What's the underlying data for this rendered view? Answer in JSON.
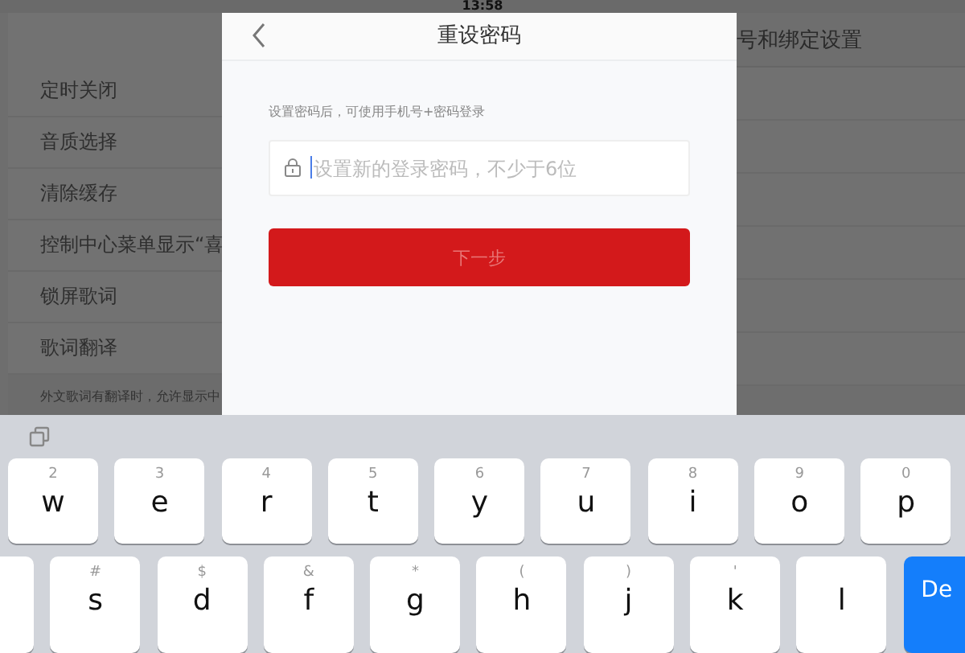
{
  "status_bar": {
    "time": "13:58"
  },
  "settings": {
    "items": [
      {
        "label": "定时关闭"
      },
      {
        "label": "音质选择"
      },
      {
        "label": "清除缓存"
      },
      {
        "label": "控制中心菜单显示“喜"
      },
      {
        "label": "锁屏歌词"
      },
      {
        "label": "歌词翻译"
      }
    ],
    "footnote": "外文歌词有翻译时，允许显示中",
    "right_header": "号和绑定设置"
  },
  "dialog": {
    "title": "重设密码",
    "hint": "设置密码后，可使用手机号+密码登录",
    "password_field": {
      "placeholder": "设置新的登录密码，不少于6位"
    },
    "next_button": {
      "label": "下一步",
      "disabled": true
    }
  },
  "keyboard": {
    "rows": [
      [
        {
          "kind": "letter",
          "label": "w",
          "secondary": "2"
        },
        {
          "kind": "letter",
          "label": "e",
          "secondary": "3"
        },
        {
          "kind": "letter",
          "label": "r",
          "secondary": "4"
        },
        {
          "kind": "letter",
          "label": "t",
          "secondary": "5"
        },
        {
          "kind": "letter",
          "label": "y",
          "secondary": "6"
        },
        {
          "kind": "letter",
          "label": "u",
          "secondary": "7"
        },
        {
          "kind": "letter",
          "label": "i",
          "secondary": "8"
        },
        {
          "kind": "letter",
          "label": "o",
          "secondary": "9"
        },
        {
          "kind": "letter",
          "label": "p",
          "secondary": "0"
        }
      ],
      [
        {
          "kind": "blank"
        },
        {
          "kind": "letter",
          "label": "s",
          "secondary": "#"
        },
        {
          "kind": "letter",
          "label": "d",
          "secondary": "$"
        },
        {
          "kind": "letter",
          "label": "f",
          "secondary": "&"
        },
        {
          "kind": "letter",
          "label": "g",
          "secondary": "*"
        },
        {
          "kind": "letter",
          "label": "h",
          "secondary": "("
        },
        {
          "kind": "letter",
          "label": "j",
          "secondary": ")"
        },
        {
          "kind": "letter",
          "label": "k",
          "secondary": "'"
        },
        {
          "kind": "letter",
          "label": "l"
        },
        {
          "kind": "action",
          "label": "De"
        }
      ]
    ]
  }
}
